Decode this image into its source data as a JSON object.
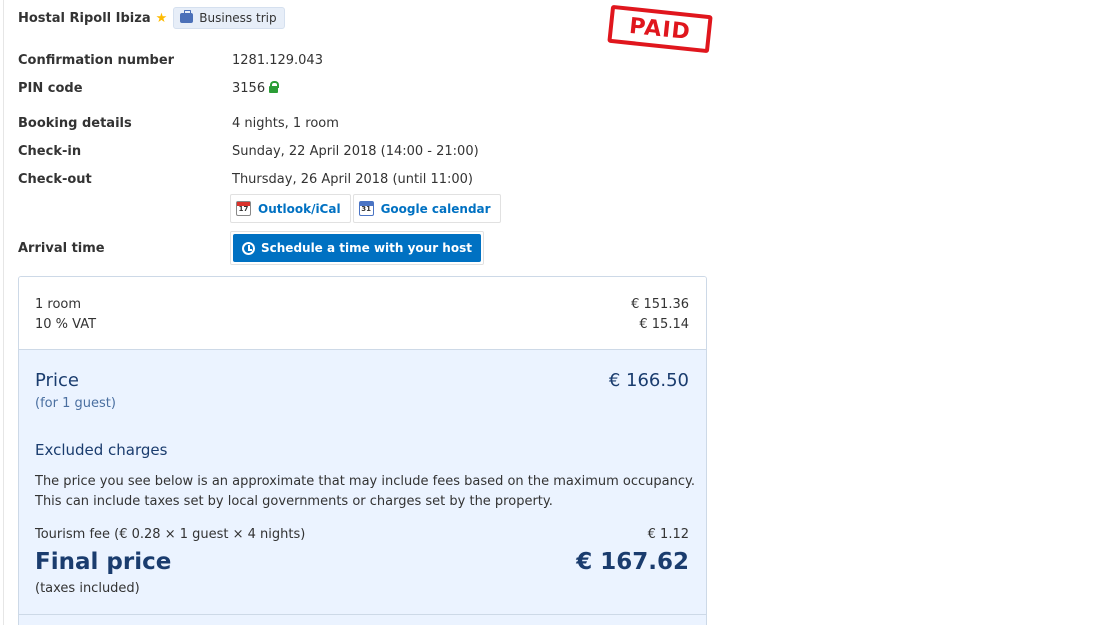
{
  "hotel": {
    "name": "Hostal Ripoll Ibiza",
    "trip_badge": "Business trip",
    "stamp": "PAID"
  },
  "details": {
    "confirmation_label": "Confirmation number",
    "confirmation_value": "1281.129.043",
    "pin_label": "PIN code",
    "pin_value": "3156",
    "booking_label": "Booking details",
    "booking_value": "4 nights, 1 room",
    "checkin_label": "Check-in",
    "checkin_value": "Sunday, 22 April 2018 (14:00 - 21:00)",
    "checkout_label": "Check-out",
    "checkout_value": "Thursday, 26 April 2018 (until 11:00)",
    "outlook_label": "Outlook/iCal",
    "google_label": "Google calendar",
    "arrival_label": "Arrival time",
    "schedule_label": "Schedule a time with your host"
  },
  "pricing": {
    "room_label": "1 room",
    "room_value": "€ 151.36",
    "vat_label": "10 % VAT",
    "vat_value": "€ 15.14",
    "price_label": "Price",
    "price_value": "€ 166.50",
    "guests_note": "(for 1 guest)",
    "excluded_title": "Excluded charges",
    "excluded_desc": "The price you see below is an approximate that may include fees based on the maximum occupancy. This can include taxes set by local governments or charges set by the property.",
    "tourism_label": "Tourism fee  (€ 0.28 × 1 guest × 4 nights)",
    "tourism_value": "€ 1.12",
    "final_label": "Final price",
    "final_value": "€ 167.62",
    "taxes_note": "(taxes included)"
  }
}
